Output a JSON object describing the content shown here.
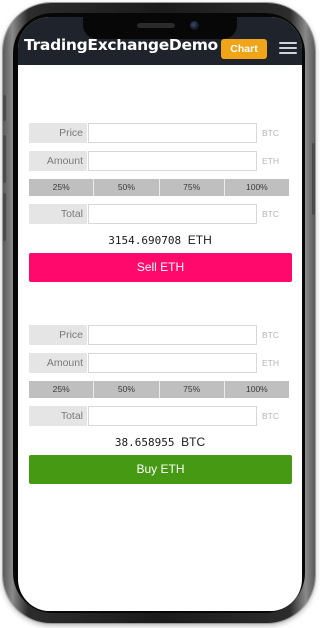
{
  "navbar": {
    "brand": "TradingExchangeDemo",
    "chart_label": "Chart",
    "menu_icon": "hamburger-menu-icon"
  },
  "sell": {
    "price_label": "Price",
    "price_value": "",
    "price_unit": "BTC",
    "amount_label": "Amount",
    "amount_value": "",
    "amount_unit": "ETH",
    "percents": [
      "25%",
      "50%",
      "75%",
      "100%"
    ],
    "total_label": "Total",
    "total_value": "",
    "total_unit": "BTC",
    "available_amount": "3154.690708",
    "available_currency": "ETH",
    "button_label": "Sell ETH",
    "button_color": "#ff0a6c"
  },
  "buy": {
    "price_label": "Price",
    "price_value": "",
    "price_unit": "BTC",
    "amount_label": "Amount",
    "amount_value": "",
    "amount_unit": "ETH",
    "percents": [
      "25%",
      "50%",
      "75%",
      "100%"
    ],
    "total_label": "Total",
    "total_value": "",
    "total_unit": "BTC",
    "available_amount": "38.658955",
    "available_currency": "BTC",
    "button_label": "Buy ETH",
    "button_color": "#469912"
  },
  "colors": {
    "navbar_bg": "#1f232b",
    "chart_button": "#f0a418",
    "label_bg": "#e5e5e5",
    "percent_bg": "#bfbfbf"
  }
}
